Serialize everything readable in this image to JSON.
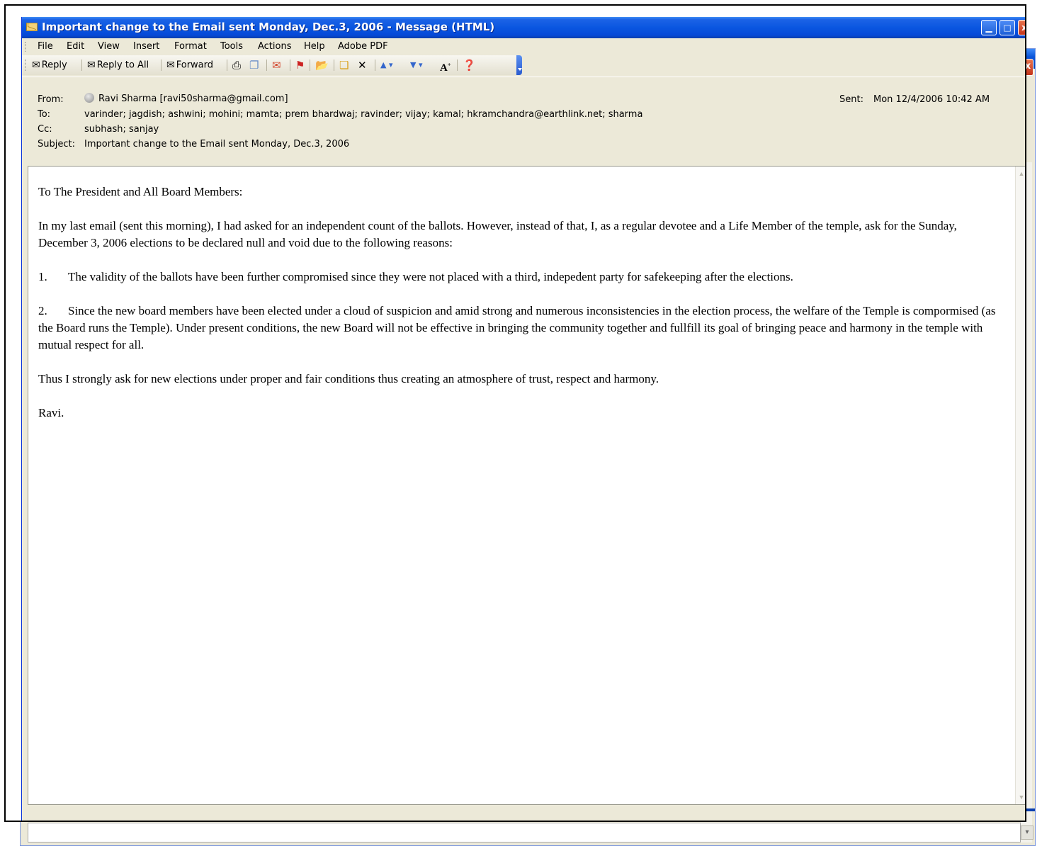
{
  "window": {
    "title": "Important change to the Email sent Monday, Dec.3, 2006 - Message (HTML)",
    "min_glyph": "▁",
    "max_glyph": "□",
    "close_glyph": "x"
  },
  "menu": [
    "File",
    "Edit",
    "View",
    "Insert",
    "Format",
    "Tools",
    "Actions",
    "Help",
    "Adobe PDF"
  ],
  "toolbar": {
    "reply_label": "Reply",
    "reply_all_label": "Reply to All",
    "forward_label": "Forward",
    "icons": [
      "print-icon",
      "copy-icon",
      "move-icon",
      "flag-icon",
      "open-folder-icon",
      "move-to-folder-icon",
      "delete-icon",
      "previous-icon",
      "next-icon",
      "font-size-icon",
      "help-icon"
    ]
  },
  "header": {
    "from_label": "From:",
    "from_value": "Ravi Sharma [ravi50sharma@gmail.com]",
    "to_label": "To:",
    "to_value": "varinder; jagdish; ashwini; mohini; mamta; prem bhardwaj; ravinder; vijay; kamal; hkramchandra@earthlink.net; sharma",
    "cc_label": "Cc:",
    "cc_value": "subhash; sanjay",
    "subject_label": "Subject:",
    "subject_value": "Important change to the Email sent Monday, Dec.3, 2006",
    "sent_label": "Sent:",
    "sent_value": "Mon 12/4/2006 10:42 AM"
  },
  "body": {
    "greeting": "To The President and All Board Members:",
    "para1": "In my last email (sent this morning), I had asked for an independent count of the ballots. However, instead of that, I, as a regular devotee and a Life Member of the temple, ask for the Sunday, December 3, 2006 elections to be declared null and void due to the following reasons:",
    "item1_num": "1.",
    "item1_text": "The validity of the ballots have been further compromised since they were not placed with a third, indepedent party for safekeeping after the elections.",
    "item2_num": "2.",
    "item2_text": "Since the new board members have been elected under a cloud of suspicion and amid strong and numerous inconsistencies in the election process, the welfare of the Temple is compormised (as the Board runs the Temple). Under present conditions, the new Board will not be effective in bringing the community together and fullfill its goal of bringing peace and harmony in the temple with mutual respect for all.",
    "para3": "Thus I strongly ask for new elections under proper and fair conditions thus creating an atmosphere of trust, respect and harmony.",
    "signature": "Ravi."
  },
  "background_window": {
    "close_glyph": "x",
    "preview_button_glyph": "▾"
  }
}
